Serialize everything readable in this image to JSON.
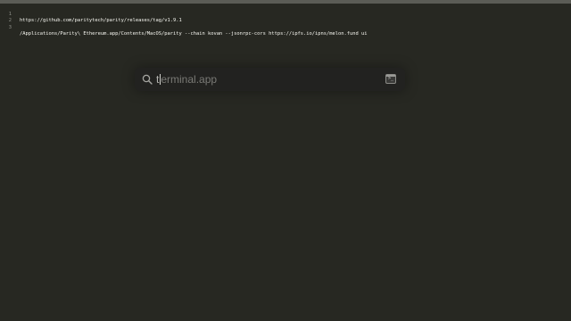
{
  "editor": {
    "lines": [
      {
        "number": "1",
        "text": "https://github.com/paritytech/parity/releases/tag/v1.9.1"
      },
      {
        "number": "2",
        "text": ""
      },
      {
        "number": "3",
        "text": "/Applications/Parity\\ Ethereum.app/Contents/MacOS/parity --chain kovan --jsonrpc-cors https://ipfs.io/ipns/melon.fund ui"
      }
    ]
  },
  "spotlight": {
    "typed": "t",
    "completion": "erminal.app",
    "search_icon": "search-icon",
    "result_icon": "terminal-app-icon",
    "result_icon_glyph": ">_"
  },
  "colors": {
    "editor_background": "#272822",
    "editor_text": "#f8f8f2",
    "gutter_text": "#8f908a",
    "spotlight_background": "#222220"
  }
}
